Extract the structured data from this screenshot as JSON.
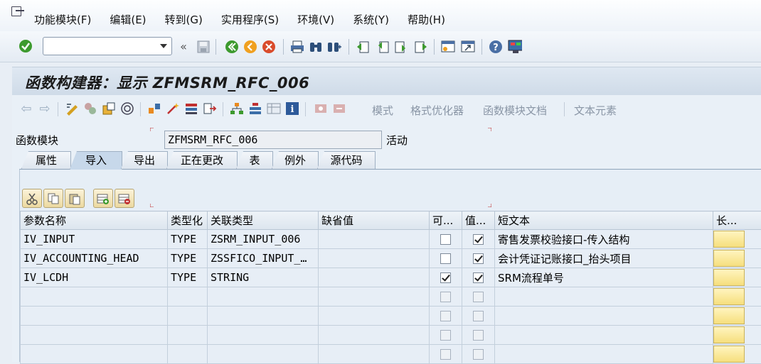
{
  "menu": [
    "功能模块(F)",
    "编辑(E)",
    "转到(G)",
    "实用程序(S)",
    "环境(V)",
    "系统(Y)",
    "帮助(H)"
  ],
  "title": "函数构建器：显示 ZFMSRM_RFC_006",
  "app_toolbar": {
    "pattern": "模式",
    "pretty_printer": "格式优化器",
    "fm_docs": "函数模块文档",
    "text_elements": "文本元素"
  },
  "function_module": {
    "label": "函数模块",
    "value": "ZFMSRM_RFC_006",
    "status": "活动"
  },
  "tabs": [
    {
      "label": "属性",
      "active": false
    },
    {
      "label": "导入",
      "active": true
    },
    {
      "label": "导出",
      "active": false
    },
    {
      "label": "正在更改",
      "active": false
    },
    {
      "label": "表",
      "active": false
    },
    {
      "label": "例外",
      "active": false
    },
    {
      "label": "源代码",
      "active": false
    }
  ],
  "table": {
    "headers": [
      "参数名称",
      "类型化",
      "关联类型",
      "缺省值",
      "可...",
      "值...",
      "短文本",
      "长..."
    ],
    "rows": [
      {
        "name": "IV_INPUT",
        "typing": "TYPE",
        "assoc": "ZSRM_INPUT_006",
        "default": "",
        "optional": false,
        "pass_value": true,
        "short_text": "寄售发票校验接口-传入结构"
      },
      {
        "name": "IV_ACCOUNTING_HEAD",
        "typing": "TYPE",
        "assoc": "ZSSFICO_INPUT_…",
        "default": "",
        "optional": false,
        "pass_value": true,
        "short_text": "会计凭证记账接口_抬头项目"
      },
      {
        "name": "IV_LCDH",
        "typing": "TYPE",
        "assoc": "STRING",
        "default": "",
        "optional": true,
        "pass_value": true,
        "short_text": "SRM流程单号"
      }
    ]
  },
  "colors": {
    "accent_green": "#3d9a2e",
    "long_text_button": "#f6df7e"
  }
}
